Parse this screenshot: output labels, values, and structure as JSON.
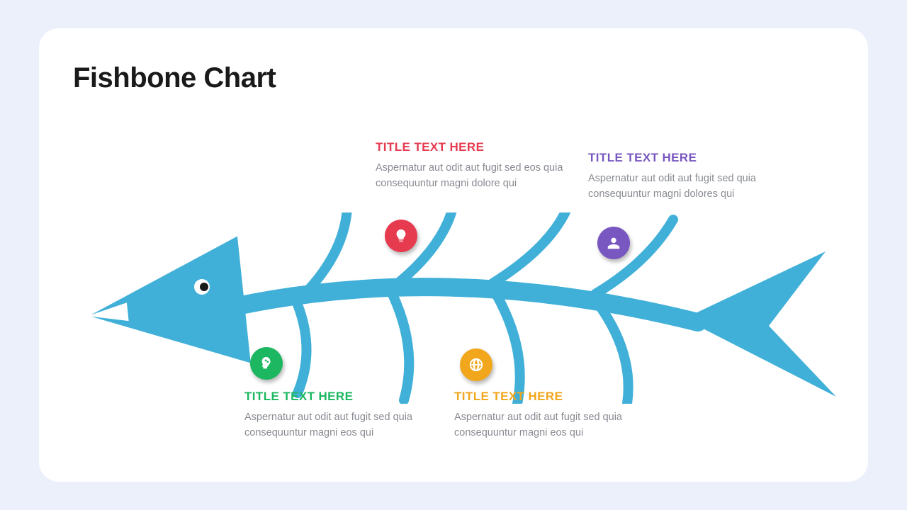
{
  "title": "Fishbone Chart",
  "items": [
    {
      "position": "top-left",
      "color": "red",
      "icon": "lightbulb",
      "title": "TITLE TEXT HERE",
      "body": "Aspernatur aut odit aut fugit sed eos quia consequuntur magni dolore qui"
    },
    {
      "position": "top-right",
      "color": "purple",
      "icon": "person",
      "title": "TITLE TEXT HERE",
      "body": "Aspernatur aut odit aut fugit sed quia consequuntur magni dolores qui"
    },
    {
      "position": "bottom-left",
      "color": "green",
      "icon": "brain-head",
      "title": "TITLE TEXT HERE",
      "body": "Aspernatur aut odit aut fugit sed quia consequuntur magni eos qui"
    },
    {
      "position": "bottom-right",
      "color": "orange",
      "icon": "globe",
      "title": "TITLE TEXT HERE",
      "body": "Aspernatur aut odit aut fugit sed quia consequuntur magni eos qui"
    }
  ]
}
